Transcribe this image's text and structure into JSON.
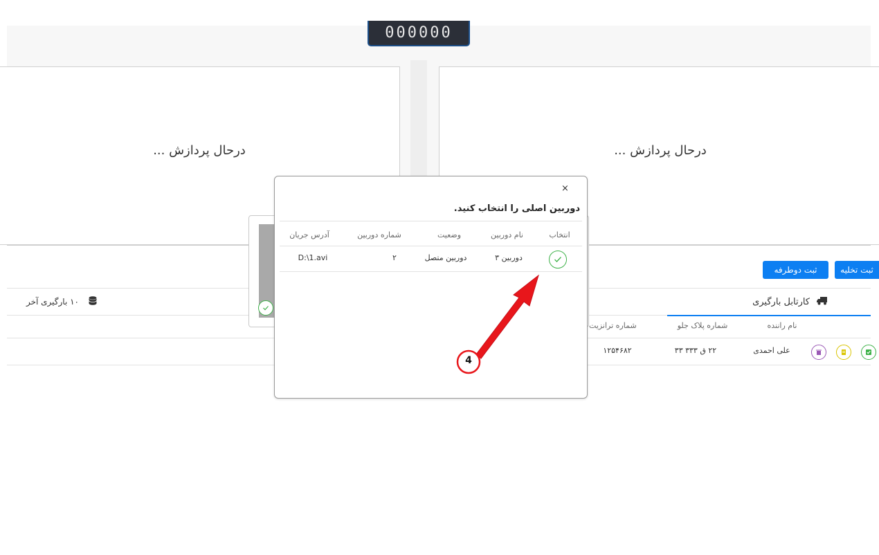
{
  "timer": {
    "display": "000000"
  },
  "camera_panels": {
    "left_status": "درحال پردازش ...",
    "right_status": "درحال پردازش ..."
  },
  "actions": {
    "double_label": "ثبت دوطرفه",
    "unload_label": "ثبت تخلیه"
  },
  "tabs": {
    "kartabl_label": "کارتابل بارگیری",
    "recent_label": "۱۰ بارگیری آخر"
  },
  "loading_table": {
    "columns": [
      "نام راننده",
      "شماره پلاک جلو",
      "شماره ترانزیت"
    ],
    "rows": [
      {
        "driver": "علی احمدی",
        "plate": "۲۲ ق ۳۳۳ ۳۳",
        "transit": "۱۲۵۴۶۸۲"
      }
    ]
  },
  "modal": {
    "close_glyph": "×",
    "title": "دوربین اصلی را انتخاب کنید.",
    "columns": [
      "انتخاب",
      "نام دوربین",
      "وضعیت",
      "شماره دوربین",
      "آدرس جریان"
    ],
    "rows": [
      {
        "name": "دوربین ۳",
        "status": "دوربین متصل",
        "number": "۲",
        "address": "D:\\1.avi"
      }
    ]
  },
  "annotation": {
    "step_number": "4",
    "color": "#e8161b"
  },
  "colors": {
    "accent": "#0d7ff2",
    "success": "#3fb24a",
    "warning": "#d9c400",
    "purple": "#9b59b6"
  },
  "icons": [
    "close-icon",
    "check-icon",
    "truck-icon",
    "database-icon",
    "trash-icon",
    "document-icon",
    "confirm-icon"
  ]
}
